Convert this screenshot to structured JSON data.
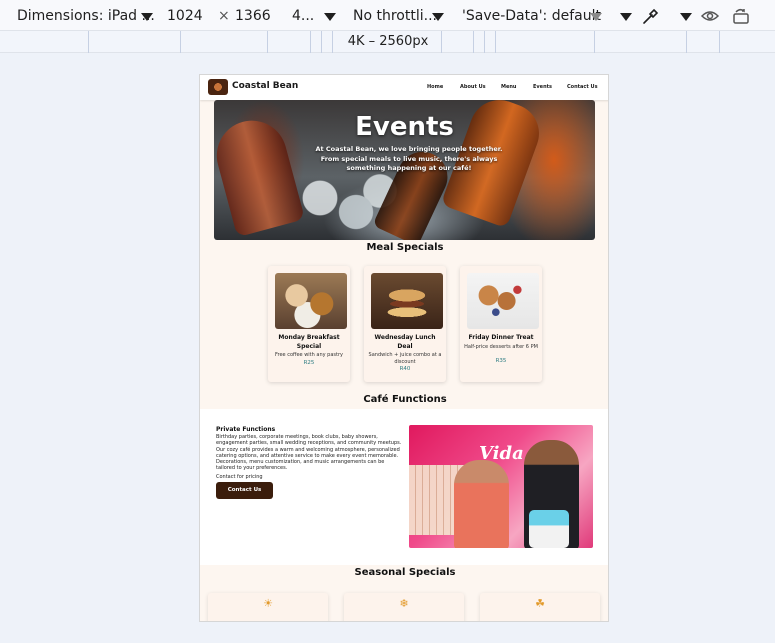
{
  "devtools": {
    "dimensions_label": "Dimensions: iPad ...",
    "width": "1024",
    "times": "×",
    "height": "1366",
    "zoom": "4...",
    "throttle": "No throttli...",
    "save_data": "'Save-Data': default",
    "media_query": "4K – 2560px"
  },
  "site": {
    "brand": "Coastal Bean",
    "nav": [
      "Home",
      "About Us",
      "Menu",
      "Events",
      "Contact Us"
    ],
    "hero": {
      "title": "Events",
      "subtitle": "At Coastal Bean, we love bringing people together. From special meals to live music, there's always something happening at our café!"
    },
    "meal_specials": {
      "heading": "Meal Specials",
      "cards": [
        {
          "title": "Monday Breakfast Special",
          "desc": "Free coffee with any pastry",
          "price": "R25"
        },
        {
          "title": "Wednesday Lunch Deal",
          "desc": "Sandwich + juice combo at a discount",
          "price": "R40"
        },
        {
          "title": "Friday Dinner Treat",
          "desc": "Half-price desserts after 6 PM",
          "price": "R35"
        }
      ]
    },
    "functions": {
      "heading": "Café Functions",
      "title": "Private Functions",
      "body": "Birthday parties, corporate meetings, book clubs, baby showers, engagement parties, small wedding receptions, and community meetups. Our cozy café provides a warm and welcoming atmosphere, personalized catering options, and attentive service to make every event memorable. Decorations, menu customization, and music arrangements can be tailored to your preferences.",
      "contact_text": "Contact for pricing",
      "button": "Contact Us",
      "image_text": "Vida"
    },
    "seasonal": {
      "heading": "Seasonal Specials",
      "icons": [
        "sun-icon",
        "snowflake-icon",
        "leaves-icon"
      ],
      "glyphs": [
        "☀",
        "❄",
        "☘"
      ]
    }
  }
}
